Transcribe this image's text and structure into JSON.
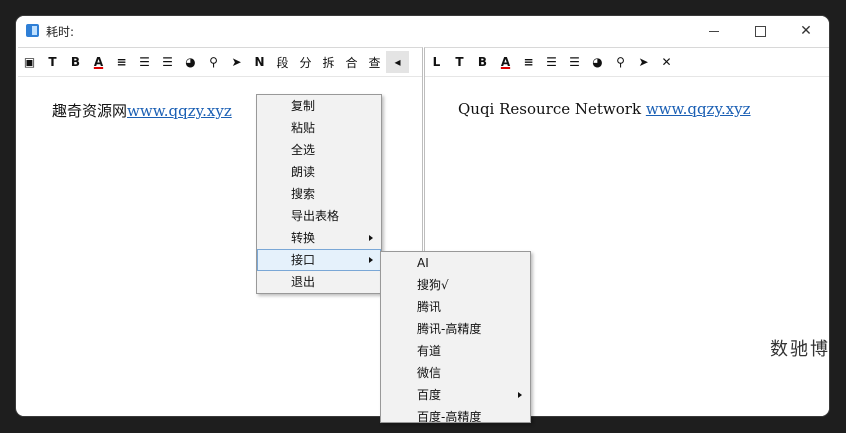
{
  "window": {
    "title": "耗时:"
  },
  "left_toolbar": {
    "buttons": [
      {
        "name": "frame-icon",
        "label": "▣"
      },
      {
        "name": "text-t-icon",
        "label": "T"
      },
      {
        "name": "bold-icon",
        "label": "B"
      },
      {
        "name": "font-color-icon",
        "label": "A"
      },
      {
        "name": "align-left-icon",
        "label": "≡"
      },
      {
        "name": "align-center-icon",
        "label": "☰"
      },
      {
        "name": "align-justify-icon",
        "label": "☰"
      },
      {
        "name": "palette-icon",
        "label": "◕"
      },
      {
        "name": "search-icon",
        "label": "⚲"
      },
      {
        "name": "send-icon",
        "label": "➤"
      },
      {
        "name": "n-icon",
        "label": "N"
      },
      {
        "name": "segment-button",
        "label": "段"
      },
      {
        "name": "split-button",
        "label": "分"
      },
      {
        "name": "break-button",
        "label": "拆"
      },
      {
        "name": "merge-button",
        "label": "合"
      },
      {
        "name": "lookup-button",
        "label": "查"
      },
      {
        "name": "collapse-left-icon",
        "label": "◂"
      }
    ]
  },
  "right_toolbar": {
    "buttons": [
      {
        "name": "text-l-icon",
        "label": "L"
      },
      {
        "name": "text-t-icon",
        "label": "T"
      },
      {
        "name": "bold-icon",
        "label": "B"
      },
      {
        "name": "font-color-icon",
        "label": "A"
      },
      {
        "name": "align-left-icon",
        "label": "≡"
      },
      {
        "name": "align-center-icon",
        "label": "☰"
      },
      {
        "name": "align-justify-icon",
        "label": "☰"
      },
      {
        "name": "palette-icon",
        "label": "◕"
      },
      {
        "name": "search-icon",
        "label": "⚲"
      },
      {
        "name": "send-icon",
        "label": "➤"
      },
      {
        "name": "close-icon",
        "label": "✕"
      }
    ]
  },
  "left_pane": {
    "text": "趣奇资源网",
    "link": "www.qqzy.xyz"
  },
  "right_pane": {
    "text": "Quqi Resource Network ",
    "link": "www.qqzy.xyz",
    "watermark": "数驰博客"
  },
  "context_menu": {
    "items": [
      {
        "label": "复制",
        "submenu": false
      },
      {
        "label": "粘贴",
        "submenu": false
      },
      {
        "label": "全选",
        "submenu": false
      },
      {
        "label": "朗读",
        "submenu": false
      },
      {
        "label": "搜索",
        "submenu": false
      },
      {
        "label": "导出表格",
        "submenu": false
      },
      {
        "label": "转换",
        "submenu": true
      },
      {
        "label": "接口",
        "submenu": true,
        "highlighted": true
      },
      {
        "label": "退出",
        "submenu": false
      }
    ]
  },
  "submenu": {
    "items": [
      {
        "label": "AI",
        "submenu": false
      },
      {
        "label": "搜狗√",
        "submenu": false
      },
      {
        "label": "腾讯",
        "submenu": false
      },
      {
        "label": "腾讯-高精度",
        "submenu": false
      },
      {
        "label": "有道",
        "submenu": false
      },
      {
        "label": "微信",
        "submenu": false
      },
      {
        "label": "百度",
        "submenu": true
      },
      {
        "label": "百度-高精度",
        "submenu": false
      }
    ]
  },
  "colors": {
    "link": "#1a5fb4",
    "menu_bg": "#f2f2f2",
    "highlight": "#e5f1fb"
  }
}
